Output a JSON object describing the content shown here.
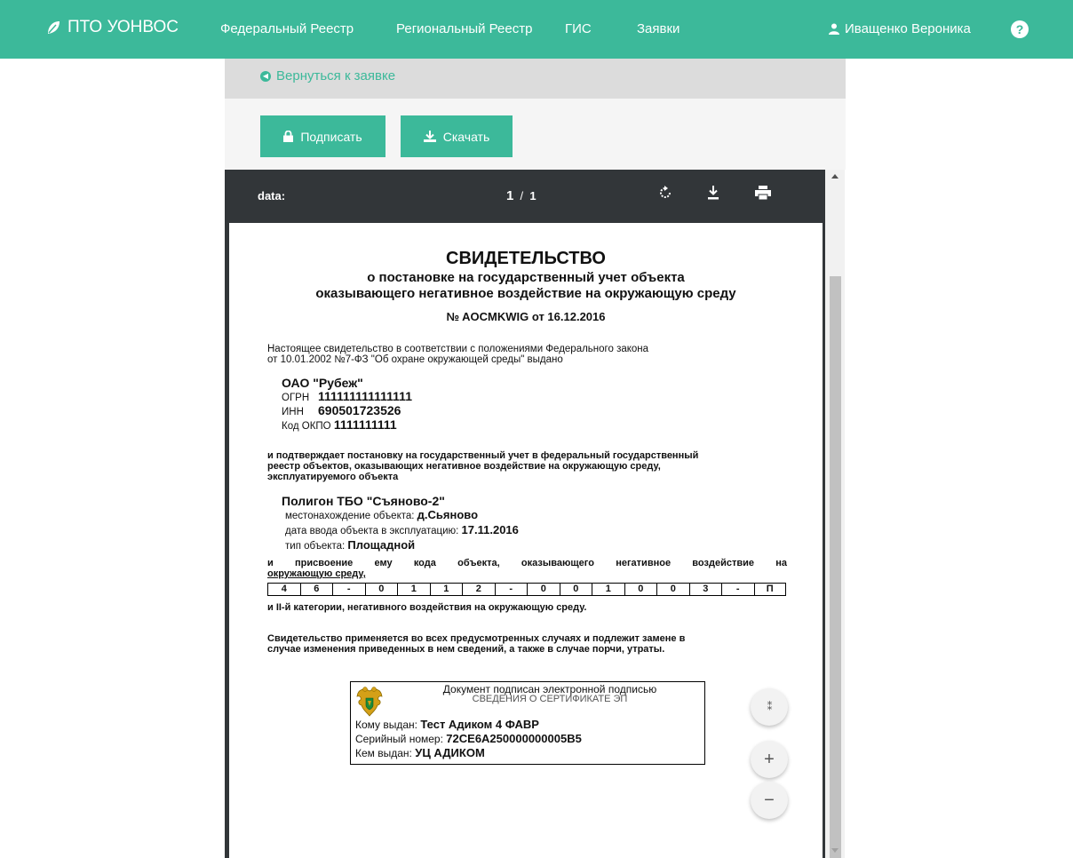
{
  "nav": {
    "brand": "ПТО УОНВОС",
    "items": [
      "Федеральный Реестр",
      "Региональный Реестр",
      "ГИС",
      "Заявки"
    ],
    "user": "Иващенко Вероника",
    "help": "?"
  },
  "back_link": "Вернуться к заявке",
  "buttons": {
    "sign": "Подписать",
    "download": "Скачать"
  },
  "viewer": {
    "title": "data:",
    "page": "1",
    "page_sep": "/",
    "page_total": "1"
  },
  "doc": {
    "title": "СВИДЕТЕЛЬСТВО",
    "subtitle1": "о постановке на государственный учет объекта",
    "subtitle2": "оказывающего негативное воздействие на окружающую среду",
    "number": "№ AOCMKWIG от 16.12.2016",
    "intro1": "Настоящее свидетельство в соответствии с положениями Федерального закона",
    "intro2": "от 10.01.2002 №7-ФЗ \"Об охране окружающей среды\" выдано",
    "org": "ОАО \"Рубеж\"",
    "ogrn_label": "ОГРН",
    "ogrn": "111111111111111",
    "inn_label": "ИНН",
    "inn": "690501723526",
    "okpo_label": "Код ОКПО",
    "okpo": "1111111111",
    "confirm1": "и подтверждает постановку на государственный учет в федеральный государственный",
    "confirm2": "реестр объектов, оказывающих негативное воздействие на окружающую среду,",
    "confirm3": "эксплуатируемого объекта",
    "object": "Полигон ТБО \"Съяново-2\"",
    "loc_label": "местонахождение объекта:",
    "loc": "д.Сьяново",
    "date_label": "дата ввода объекта в эксплуатацию:",
    "date": "17.11.2016",
    "type_label": "тип объекта:",
    "type": "Площадной",
    "assign1": "и присвоение ему кода объекта, оказывающего негативное воздействие на",
    "assign2": "окружающую среду,",
    "code": [
      "4",
      "6",
      "-",
      "0",
      "1",
      "1",
      "2",
      "-",
      "0",
      "0",
      "1",
      "0",
      "0",
      "3",
      "-",
      "П"
    ],
    "category": "и II-й категории, негативного воздействия на окружающую среду.",
    "note1": "Свидетельство применяется во всех предусмотренных случаях и подлежит замене в",
    "note2": "случае изменения приведенных в нем сведений, а также в случае порчи, утраты."
  },
  "signature": {
    "header": "Документ подписан электронной подписью",
    "cert_info": "СВЕДЕНИЯ О СЕРТИФИКАТЕ ЭП",
    "issued_to_label": "Кому выдан:",
    "issued_to": "Тест Адиком 4 ФАВР",
    "serial_label": "Серийный номер:",
    "serial": "72CE6A250000000005B5",
    "issued_by_label": "Кем выдан:",
    "issued_by": "УЦ АДИКОМ"
  },
  "colors": {
    "accent": "#3cb99a",
    "viewer_dark": "#323639"
  },
  "icons": [
    "leaf-icon",
    "user-icon",
    "help-icon",
    "back-arrow-icon",
    "lock-icon",
    "download-icon",
    "rotate-icon",
    "print-icon",
    "fit-page-icon",
    "zoom-in-icon",
    "zoom-out-icon"
  ]
}
